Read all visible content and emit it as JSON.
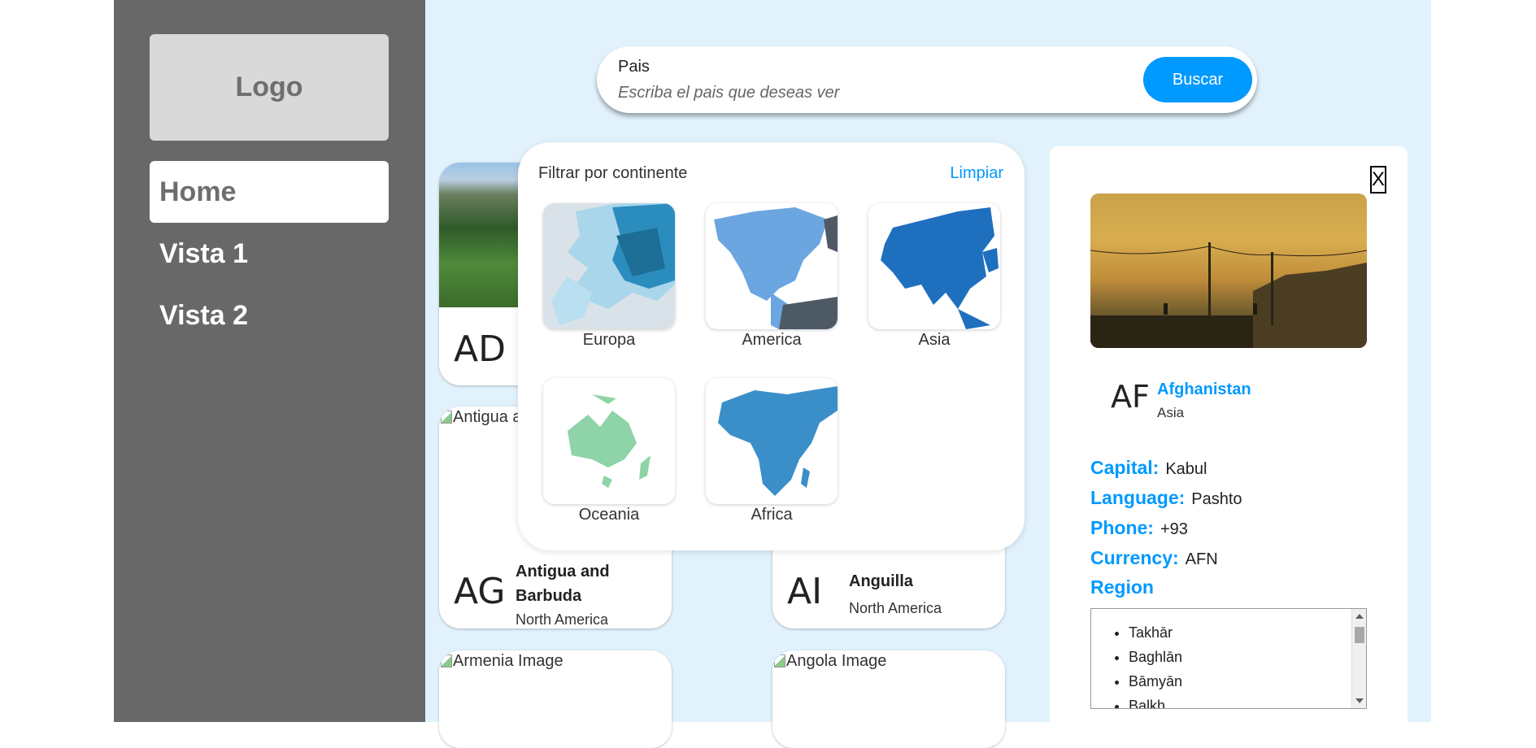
{
  "sidebar": {
    "logo": "Logo",
    "items": [
      {
        "label": "Home"
      },
      {
        "label": "Vista 1"
      },
      {
        "label": "Vista 2"
      }
    ]
  },
  "search": {
    "label": "Pais",
    "placeholder": "Escriba el pais que deseas ver",
    "button": "Buscar"
  },
  "cards": [
    {
      "code": "AD",
      "name": "",
      "continent": "",
      "image_alt": ""
    },
    {
      "code": "AG",
      "name": "Antigua and Barbuda",
      "continent": "North America",
      "image_alt": "Antigua a"
    },
    {
      "code": "AI",
      "name": "Anguilla",
      "continent": "North America",
      "image_alt": ""
    },
    {
      "code": "",
      "name": "",
      "continent": "",
      "image_alt": "Armenia Image"
    },
    {
      "code": "",
      "name": "",
      "continent": "",
      "image_alt": "Angola Image"
    }
  ],
  "filter": {
    "title": "Filtrar por continente",
    "clear": "Limpiar",
    "continents": [
      {
        "label": "Europa",
        "color": "#2b8cbe"
      },
      {
        "label": "America",
        "color": "#6ca6e0"
      },
      {
        "label": "Asia",
        "color": "#1f6fbf"
      },
      {
        "label": "Oceania",
        "color": "#8fd3a8"
      },
      {
        "label": "Africa",
        "color": "#3b8fc8"
      }
    ]
  },
  "detail": {
    "close": "X",
    "code": "AF",
    "name": "Afghanistan",
    "continent": "Asia",
    "capital_label": "Capital:",
    "capital": "Kabul",
    "language_label": "Language:",
    "language": "Pashto",
    "phone_label": "Phone:",
    "phone": "+93",
    "currency_label": "Currency:",
    "currency": "AFN",
    "region_label": "Region",
    "regions": [
      "Takhār",
      "Baghlān",
      "Bāmyān",
      "Balkh"
    ]
  },
  "colors": {
    "accent": "#0099ff",
    "sidebar": "#686868",
    "background": "#e1f2fd"
  }
}
